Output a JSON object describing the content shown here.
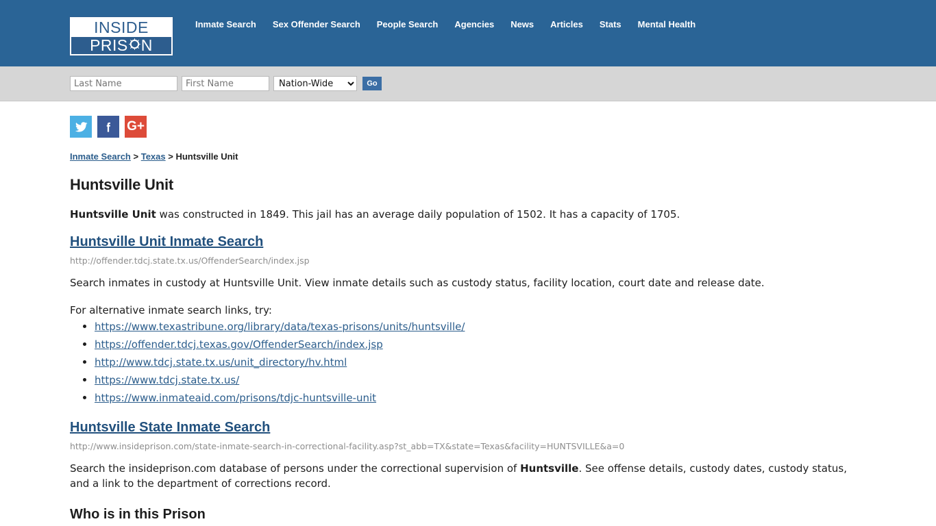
{
  "header": {
    "logo": {
      "top_text": "INSIDE",
      "bottom_text_before": "PRIS",
      "bottom_text_after": "N",
      "icon": "barbed-circle-icon"
    },
    "background_color": "#2a6496",
    "nav": [
      {
        "label": "Inmate Search"
      },
      {
        "label": "Sex Offender Search"
      },
      {
        "label": "People Search"
      },
      {
        "label": "Agencies"
      },
      {
        "label": "News"
      },
      {
        "label": "Articles"
      },
      {
        "label": "Stats"
      },
      {
        "label": "Mental Health"
      }
    ]
  },
  "search": {
    "last_name_placeholder": "Last Name",
    "last_name_value": "",
    "first_name_placeholder": "First Name",
    "first_name_value": "",
    "scope_selected": "Nation-Wide",
    "scope_options": [
      "Nation-Wide"
    ],
    "go_label": "Go",
    "go_color": "#3b6ea5",
    "background_color": "#d6d6d6"
  },
  "social": [
    {
      "name": "twitter-icon",
      "label": "Twitter",
      "color": "#4cb0e4"
    },
    {
      "name": "facebook-icon",
      "label": "Facebook",
      "color": "#3b5998"
    },
    {
      "name": "google-plus-icon",
      "label": "Google Plus",
      "color": "#dd4b39",
      "glyph": "G+"
    }
  ],
  "breadcrumb": {
    "items": [
      {
        "label": "Inmate Search",
        "is_link": true
      },
      {
        "label": "Texas",
        "is_link": true
      },
      {
        "label": "Huntsville Unit",
        "is_link": false
      }
    ],
    "separator": ">"
  },
  "main": {
    "page_title": "Huntsville Unit",
    "intro": {
      "facility_name": "Huntsville Unit",
      "text_after": " was constructed in 1849. This jail has an average daily population of 1502. It has a capacity of 1705.",
      "year_constructed": "1849",
      "average_daily_population": "1502",
      "capacity": "1705"
    },
    "sections": [
      {
        "heading": "Huntsville Unit Inmate Search",
        "url": "http://offender.tdcj.state.tx.us/OffenderSearch/index.jsp",
        "description": "Search inmates in custody at Huntsville Unit. View inmate details such as custody status, facility location, court date and release date."
      },
      {
        "heading": "Huntsville State Inmate Search",
        "url": "http://www.insideprison.com/state-inmate-search-in-correctional-facility.asp?st_abb=TX&state=Texas&facility=HUNTSVILLE&a=0",
        "description_before": "Search the insideprison.com database of persons under the correctional supervision of ",
        "description_bold": "Huntsville",
        "description_after": ". See offense details, custody dates, custody status, and a link to the department of corrections record."
      }
    ],
    "alternative_links_intro": "For alternative inmate search links, try:",
    "alternative_links": [
      {
        "label": "https://www.texastribune.org/library/data/texas-prisons/units/huntsville/"
      },
      {
        "label": "https://offender.tdcj.texas.gov/OffenderSearch/index.jsp"
      },
      {
        "label": "http://www.tdcj.state.tx.us/unit_directory/hv.html"
      },
      {
        "label": "https://www.tdcj.state.tx.us/"
      },
      {
        "label": "https://www.inmateaid.com/prisons/tdjc-huntsville-unit"
      }
    ],
    "who_heading": "Who is in this Prison"
  },
  "colors": {
    "link": "#2b5d8c",
    "heading_link": "#21507d",
    "url_text": "#8d8d8d",
    "body_text": "#1d1d1d"
  }
}
